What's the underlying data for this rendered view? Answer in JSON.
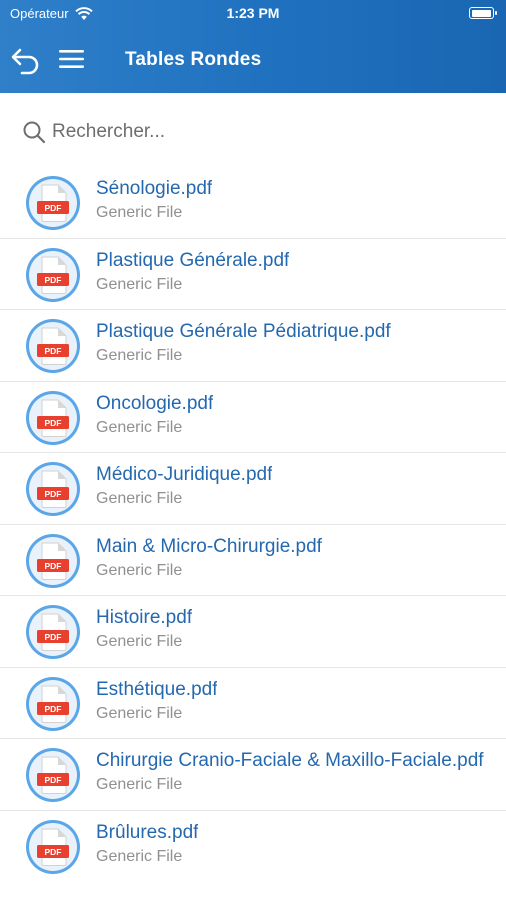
{
  "status_bar": {
    "carrier": "Opérateur",
    "time": "1:23 PM"
  },
  "header": {
    "title": "Tables Rondes"
  },
  "search": {
    "placeholder": "Rechercher..."
  },
  "colors": {
    "header": "#1f71bf",
    "link": "#2468b0",
    "pdf_badge": "#e8402f",
    "icon_circle": "#5aa6e8"
  },
  "files": [
    {
      "name": "Sénologie.pdf",
      "type": "Generic File",
      "badge": "PDF"
    },
    {
      "name": "Plastique Générale.pdf",
      "type": "Generic File",
      "badge": "PDF"
    },
    {
      "name": "Plastique Générale Pédiatrique.pdf",
      "type": "Generic File",
      "badge": "PDF"
    },
    {
      "name": "Oncologie.pdf",
      "type": "Generic File",
      "badge": "PDF"
    },
    {
      "name": "Médico-Juridique.pdf",
      "type": "Generic File",
      "badge": "PDF"
    },
    {
      "name": "Main & Micro-Chirurgie.pdf",
      "type": "Generic File",
      "badge": "PDF"
    },
    {
      "name": "Histoire.pdf",
      "type": "Generic File",
      "badge": "PDF"
    },
    {
      "name": "Esthétique.pdf",
      "type": "Generic File",
      "badge": "PDF"
    },
    {
      "name": "Chirurgie Cranio-Faciale & Maxillo-Faciale.pdf",
      "type": "Generic File",
      "badge": "PDF"
    },
    {
      "name": "Brûlures.pdf",
      "type": "Generic File",
      "badge": "PDF"
    }
  ]
}
